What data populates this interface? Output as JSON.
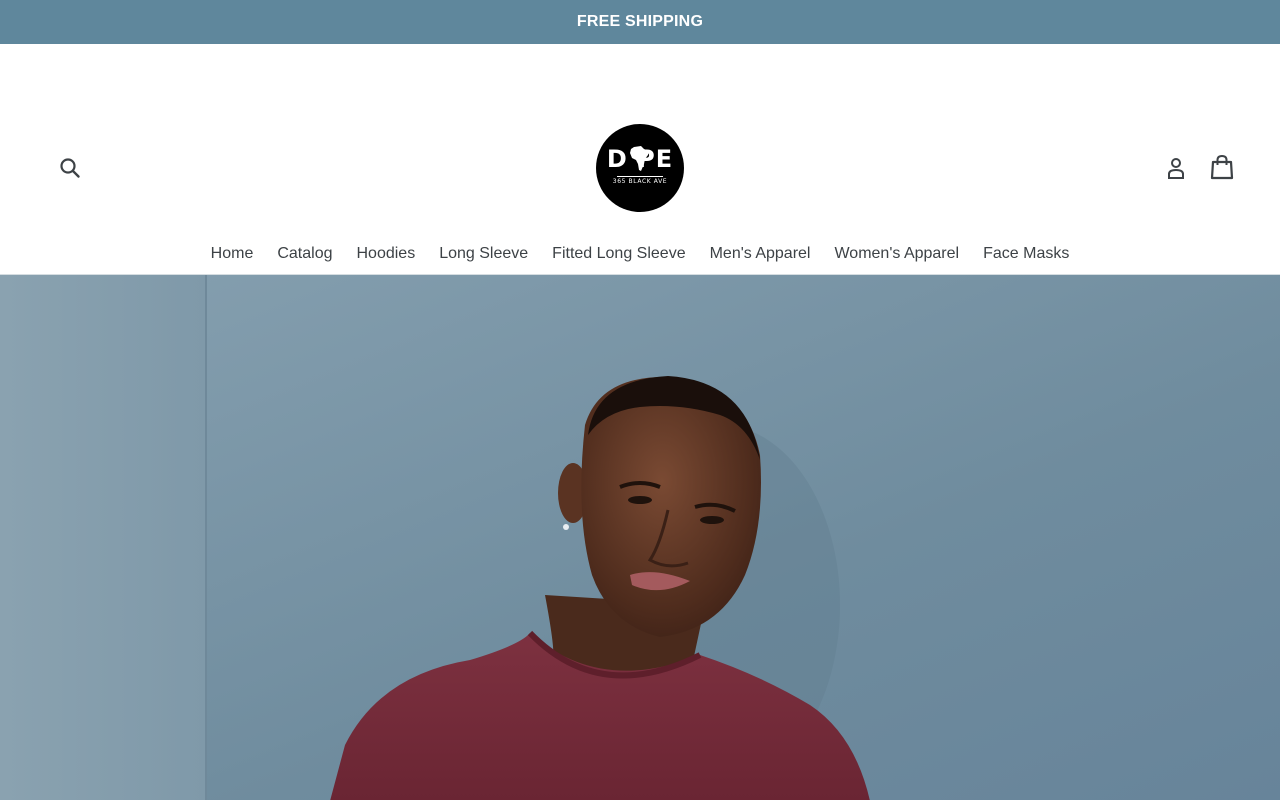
{
  "announcement": {
    "text": "FREE SHIPPING"
  },
  "colors": {
    "announcement_bg": "#5f879c",
    "nav_text": "#3d4246",
    "hero_wall": "#7a97a8",
    "shirt": "#7a2e3a"
  },
  "header": {
    "logo": {
      "word": "D PE",
      "subtitle": "365 BLACK AVE"
    },
    "icons": {
      "search": "search-icon",
      "account": "account-icon",
      "cart": "cart-icon"
    }
  },
  "nav": {
    "items": [
      {
        "label": "Home"
      },
      {
        "label": "Catalog"
      },
      {
        "label": "Hoodies"
      },
      {
        "label": "Long Sleeve"
      },
      {
        "label": "Fitted Long Sleeve"
      },
      {
        "label": "Men's Apparel"
      },
      {
        "label": "Women's Apparel"
      },
      {
        "label": "Face Masks"
      }
    ]
  }
}
